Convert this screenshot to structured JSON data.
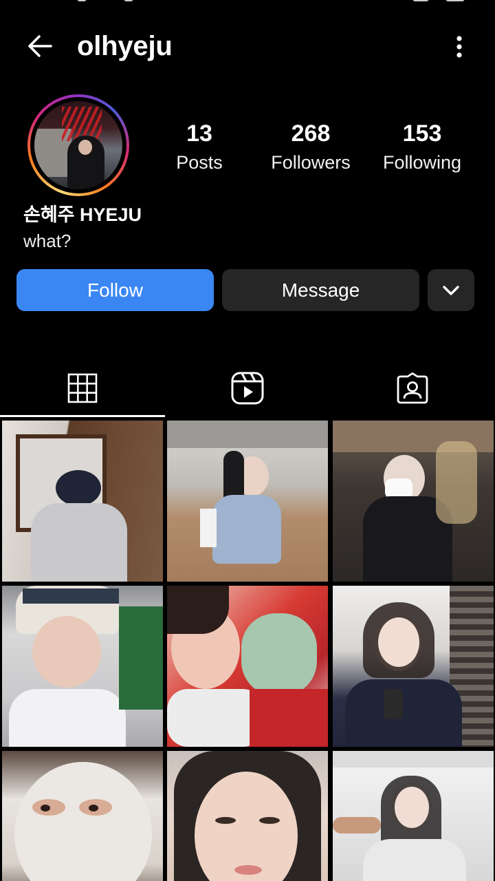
{
  "header": {
    "username": "olhyeju",
    "back_icon": "arrow-left-icon",
    "more_icon": "more-vertical-icon"
  },
  "profile": {
    "display_name": "손혜주 HYEJU",
    "bio": "what?",
    "stats": {
      "posts": {
        "count": "13",
        "label": "Posts"
      },
      "followers": {
        "count": "268",
        "label": "Followers"
      },
      "following": {
        "count": "153",
        "label": "Following"
      }
    }
  },
  "actions": {
    "follow_label": "Follow",
    "message_label": "Message",
    "suggest_icon": "chevron-down-icon"
  },
  "tabs": [
    {
      "name": "posts-grid",
      "icon": "grid-icon",
      "active": true
    },
    {
      "name": "reels",
      "icon": "reels-icon",
      "active": false
    },
    {
      "name": "tagged",
      "icon": "tagged-user-icon",
      "active": false
    }
  ],
  "colors": {
    "background": "#000000",
    "follow_button": "#3a87f3",
    "secondary_button": "#262626",
    "text": "#ffffff"
  }
}
